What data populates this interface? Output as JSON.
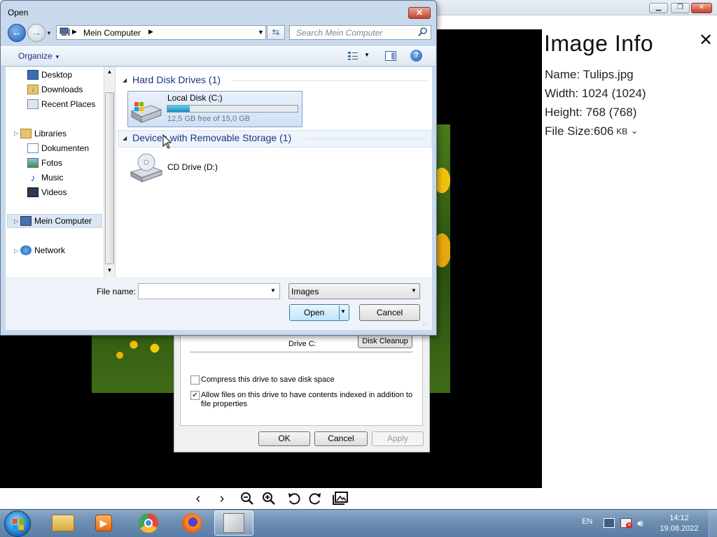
{
  "viewer": {
    "caption_buttons": [
      "▁",
      "❐",
      "✕"
    ],
    "toolbar_icons": [
      "previous-icon",
      "next-icon",
      "zoom-out-icon",
      "zoom-in-icon",
      "rotate-left-icon",
      "rotate-right-icon",
      "gallery-icon"
    ]
  },
  "image_info": {
    "title": "Image Info",
    "name": "Name: Tulips.jpg",
    "width": "Width: 1024 (1024)",
    "height": "Height: 768 (768)",
    "filesize_label": "File Size:",
    "filesize_value": "606",
    "filesize_unit": "KB",
    "close_glyph": "✕"
  },
  "properties_dialog": {
    "drive_label": "Drive C:",
    "disk_cleanup": "Disk Cleanup",
    "compress_label": "Compress this drive to save disk space",
    "compress_checked": false,
    "index_label_1": "Allow files on this drive to have contents indexed in addition to",
    "index_label_2": "file properties",
    "index_checked": true,
    "ok": "OK",
    "cancel": "Cancel",
    "apply": "Apply"
  },
  "open_dialog": {
    "title": "Open",
    "address": "Mein Computer",
    "search_placeholder": "Search Mein Computer",
    "organize": "Organize",
    "nav_items": {
      "desktop": "Desktop",
      "downloads": "Downloads",
      "recent": "Recent Places",
      "libraries": "Libraries",
      "dokumenten": "Dokumenten",
      "fotos": "Fotos",
      "music": "Music",
      "videos": "Videos",
      "computer": "Mein Computer",
      "network": "Network"
    },
    "groups": {
      "hdd": "Hard Disk Drives (1)",
      "removable": "Devices with Removable Storage (1)"
    },
    "local_disk": {
      "name": "Local Disk (C:)",
      "free": "12,5 GB free of 15,0 GB",
      "used_fraction": 0.17
    },
    "cd_drive": "CD Drive (D:)",
    "file_name_label": "File name:",
    "file_name_value": "",
    "file_type": "Images",
    "open": "Open",
    "cancel": "Cancel"
  },
  "taskbar": {
    "language": "EN",
    "time": "14:12",
    "date": "19.08.2022"
  }
}
